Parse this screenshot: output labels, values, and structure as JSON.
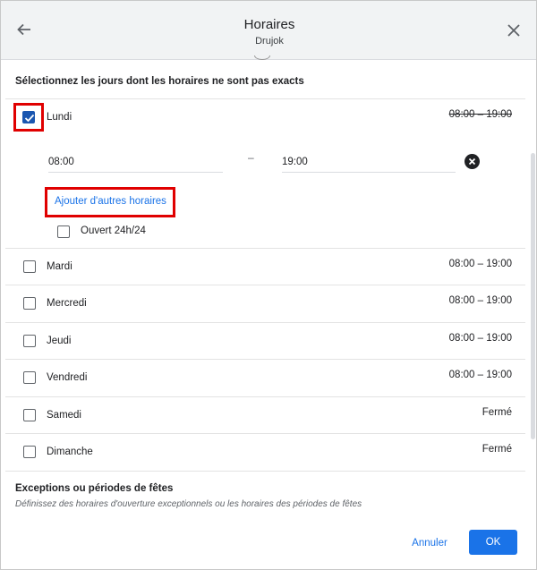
{
  "header": {
    "title": "Horaires",
    "subtitle": "Drujok",
    "back_icon": "arrow-left-icon",
    "close_icon": "close-icon"
  },
  "instruction": "Sélectionnez les jours dont les horaires ne sont pas exacts",
  "days": [
    {
      "label": "Lundi",
      "hours": "08:00 – 19:00",
      "checked": true
    },
    {
      "label": "Mardi",
      "hours": "08:00 – 19:00",
      "checked": false
    },
    {
      "label": "Mercredi",
      "hours": "08:00 – 19:00",
      "checked": false
    },
    {
      "label": "Jeudi",
      "hours": "08:00 – 19:00",
      "checked": false
    },
    {
      "label": "Vendredi",
      "hours": "08:00 – 19:00",
      "checked": false
    },
    {
      "label": "Samedi",
      "hours": "Fermé",
      "checked": false
    },
    {
      "label": "Dimanche",
      "hours": "Fermé",
      "checked": false
    }
  ],
  "editor": {
    "open_time": "08:00",
    "separator": "–",
    "close_time": "19:00",
    "add_hours_link": "Ajouter d'autres horaires",
    "open_24h_label": "Ouvert 24h/24",
    "open_24h_checked": false
  },
  "exceptions": {
    "title": "Exceptions ou périodes de fêtes",
    "subtitle": "Définissez des horaires d'ouverture exceptionnels ou les horaires des périodes de fêtes"
  },
  "footer": {
    "cancel_label": "Annuler",
    "ok_label": "OK"
  },
  "colors": {
    "accent": "#1a73e8",
    "highlight": "#e00000",
    "checkbox_checked": "#1a56b0"
  }
}
